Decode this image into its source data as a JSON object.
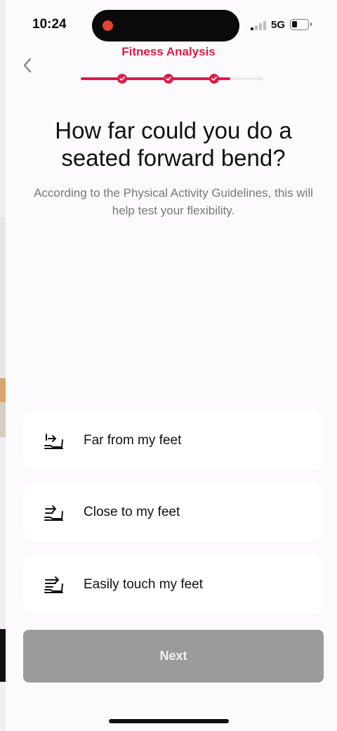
{
  "status": {
    "time": "10:24",
    "network": "5G"
  },
  "header": {
    "title": "Fitness Analysis"
  },
  "progress": {
    "steps_total": 4,
    "steps_done": 3,
    "fraction": 0.82
  },
  "question": {
    "title": "How far could you do a seated forward bend?",
    "subtitle": "According to the Physical Activity Guidelines, this will help test your flexibility."
  },
  "options": [
    {
      "label": "Far from my feet",
      "icon": "stretch-far-icon"
    },
    {
      "label": "Close to my feet",
      "icon": "stretch-close-icon"
    },
    {
      "label": "Easily touch my feet",
      "icon": "stretch-touch-icon"
    }
  ],
  "actions": {
    "next_label": "Next"
  },
  "colors": {
    "accent": "#d81e4a",
    "disabled_button": "#9c9a9c"
  }
}
